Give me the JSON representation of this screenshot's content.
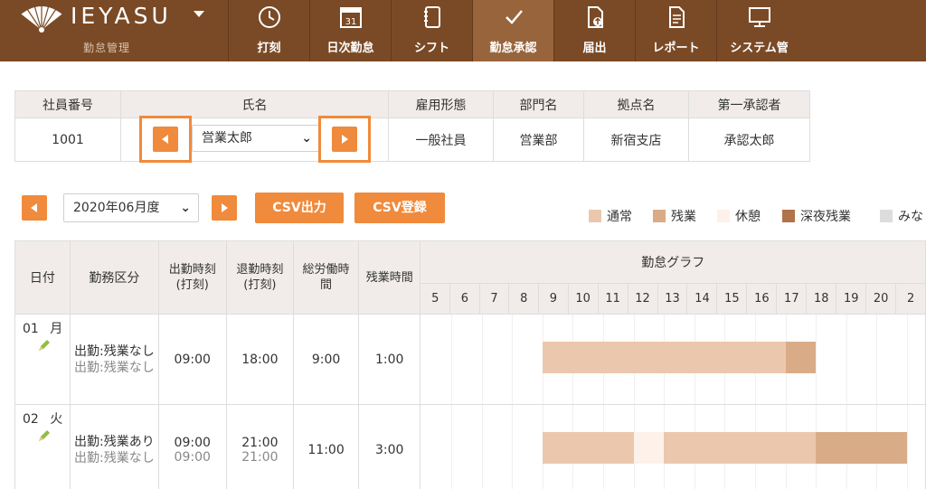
{
  "app": {
    "name": "IEYASU",
    "subtitle": "勤怠管理"
  },
  "nav": [
    {
      "label": "打刻",
      "icon": "clock-icon"
    },
    {
      "label": "日次勤怠",
      "icon": "calendar-icon"
    },
    {
      "label": "シフト",
      "icon": "notebook-icon"
    },
    {
      "label": "勤怠承認",
      "icon": "checkmark-icon"
    },
    {
      "label": "届出",
      "icon": "document-upload-icon"
    },
    {
      "label": "レポート",
      "icon": "report-icon"
    },
    {
      "label": "システム管",
      "icon": "monitor-icon"
    }
  ],
  "employee": {
    "headers": {
      "id": "社員番号",
      "name": "氏名",
      "type": "雇用形態",
      "dept": "部門名",
      "site": "拠点名",
      "approver": "第一承認者"
    },
    "values": {
      "id": "1001",
      "name": "営業太郎",
      "type": "一般社員",
      "dept": "営業部",
      "site": "新宿支店",
      "approver": "承認太郎"
    }
  },
  "toolbar": {
    "month": "2020年06月度",
    "csv_export": "CSV出力",
    "csv_import": "CSV登録"
  },
  "legend": [
    {
      "label": "通常",
      "color": "#ebc8ad"
    },
    {
      "label": "残業",
      "color": "#d9ac87"
    },
    {
      "label": "休憩",
      "color": "#fdf1ea"
    },
    {
      "label": "深夜残業",
      "color": "#b0734a"
    },
    {
      "label": "みな",
      "color": "#dddddd"
    }
  ],
  "table": {
    "headers": {
      "date": "日付",
      "kubun": "勤務区分",
      "in": "出勤時刻\n(打刻)",
      "out": "退勤時刻\n(打刻)",
      "total": "総労働時\n間",
      "overtime": "残業時間",
      "graph": "勤怠グラフ"
    },
    "hours": [
      "5",
      "6",
      "7",
      "8",
      "9",
      "10",
      "11",
      "12",
      "13",
      "14",
      "15",
      "16",
      "17",
      "18",
      "19",
      "20",
      "2"
    ],
    "rows": [
      {
        "day": "01",
        "weekday": "月",
        "kubun": "出勤:残業なし",
        "kubun_sub": "出勤:残業なし",
        "in": "09:00",
        "in_sub": "",
        "out": "18:00",
        "out_sub": "",
        "total": "9:00",
        "overtime": "1:00"
      },
      {
        "day": "02",
        "weekday": "火",
        "kubun": "出勤:残業あり",
        "kubun_sub": "出勤:残業なし",
        "in": "09:00",
        "in_sub": "09:00",
        "out": "21:00",
        "out_sub": "21:00",
        "total": "11:00",
        "overtime": "3:00"
      }
    ]
  },
  "graph_segments": [
    [
      {
        "start": 9,
        "end": 17,
        "type": "通常"
      },
      {
        "start": 17,
        "end": 18,
        "type": "残業"
      }
    ],
    [
      {
        "start": 9,
        "end": 12,
        "type": "通常"
      },
      {
        "start": 12,
        "end": 13,
        "type": "休憩"
      },
      {
        "start": 13,
        "end": 18,
        "type": "通常"
      },
      {
        "start": 18,
        "end": 21,
        "type": "残業"
      }
    ]
  ]
}
